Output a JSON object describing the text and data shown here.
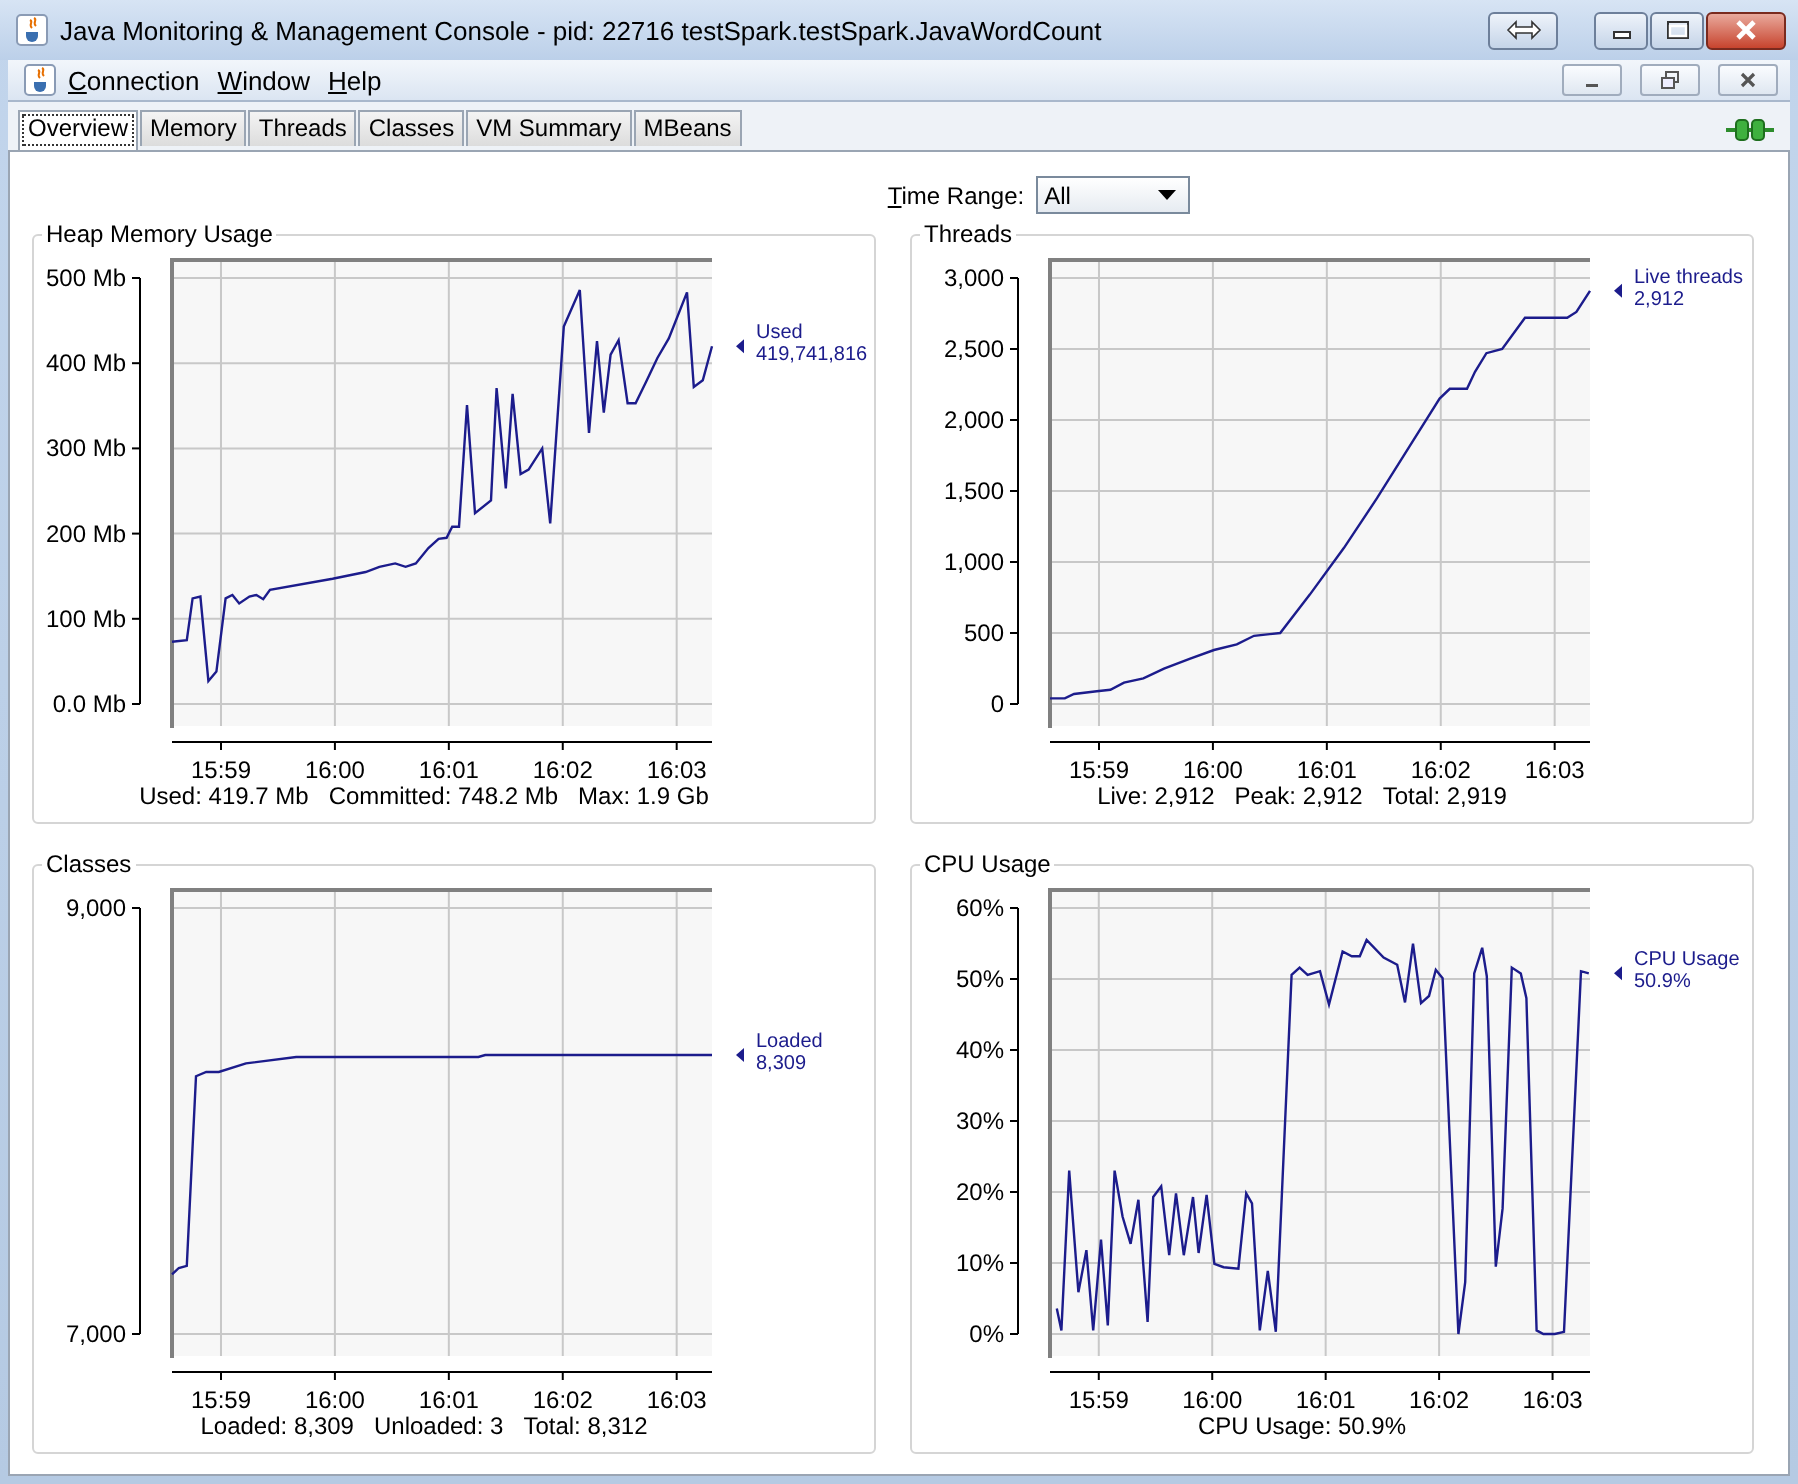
{
  "window": {
    "title": "Java Monitoring & Management Console - pid: 22716 testSpark.testSpark.JavaWordCount"
  },
  "menu": [
    "Connection",
    "Window",
    "Help"
  ],
  "tabs": [
    {
      "label": "Overview",
      "selected": true
    },
    {
      "label": "Memory",
      "selected": false
    },
    {
      "label": "Threads",
      "selected": false
    },
    {
      "label": "Classes",
      "selected": false
    },
    {
      "label": "VM Summary",
      "selected": false
    },
    {
      "label": "MBeans",
      "selected": false
    }
  ],
  "time_range": {
    "label": "Time Range:",
    "value": "All"
  },
  "panels": [
    {
      "title": "Heap Memory Usage",
      "legend": {
        "value": "419,741,816"
      },
      "stats": [
        "Used: 419.7 Mb",
        "Committed: 748.2 Mb",
        "Max: 1.9 Gb"
      ],
      "chart_data": {
        "type": "line",
        "x": [
          958.57,
          958.7,
          958.75,
          958.82,
          958.89,
          958.96,
          959.04,
          959.1,
          959.16,
          959.25,
          959.31,
          959.37,
          959.43,
          959.98,
          960.27,
          960.39,
          960.53,
          960.62,
          960.71,
          960.82,
          960.91,
          960.98,
          961.03,
          961.09,
          961.16,
          961.23,
          961.37,
          961.42,
          961.5,
          961.56,
          961.63,
          961.7,
          961.82,
          961.89,
          962.01,
          962.15,
          962.23,
          962.3,
          962.36,
          962.42,
          962.49,
          962.57,
          962.64,
          962.73,
          962.83,
          962.93,
          963.09,
          963.15,
          963.23,
          963.31
        ],
        "series": [
          {
            "name": "Used",
            "color": "#1c1c8c",
            "values": [
              73,
              75,
              124,
              126,
              27,
              38,
              124,
              128,
              118,
              126,
              128,
              123,
              134,
              147,
              155,
              161,
              165,
              161,
              165,
              183,
              194,
              195,
              208,
              208,
              351,
              224,
              239,
              371,
              253,
              364,
              270,
              275,
              300,
              212,
              443,
              486,
              318,
              426,
              342,
              410,
              427,
              353,
              353,
              378,
              406,
              429,
              483,
              372,
              380,
              420
            ]
          }
        ],
        "grid": true,
        "xlim": [
          958.57,
          963.31
        ],
        "ylim": [
          0,
          500
        ],
        "xticks": [
          {
            "value": 959,
            "label": "15:59"
          },
          {
            "value": 960,
            "label": "16:00"
          },
          {
            "value": 961,
            "label": "16:01"
          },
          {
            "value": 962,
            "label": "16:02"
          },
          {
            "value": 963,
            "label": "16:03"
          }
        ],
        "yticks": [
          {
            "value": 0,
            "label": "0.0 Mb"
          },
          {
            "value": 100,
            "label": "100 Mb"
          },
          {
            "value": 200,
            "label": "200 Mb"
          },
          {
            "value": 300,
            "label": "300 Mb"
          },
          {
            "value": 400,
            "label": "400 Mb"
          },
          {
            "value": 500,
            "label": "500 Mb"
          }
        ]
      }
    },
    {
      "title": "Threads",
      "legend": {
        "value": "2,912"
      },
      "stats": [
        "Live: 2,912",
        "Peak: 2,912",
        "Total: 2,919"
      ],
      "chart_data": {
        "type": "line",
        "x": [
          958.57,
          958.7,
          958.78,
          958.98,
          959.1,
          959.22,
          959.39,
          959.57,
          959.8,
          960.01,
          960.21,
          960.36,
          960.59,
          960.85,
          961.15,
          961.44,
          961.73,
          961.99,
          962.08,
          962.23,
          962.3,
          962.4,
          962.54,
          962.74,
          963.11,
          963.19,
          963.31
        ],
        "series": [
          {
            "name": "Live threads",
            "color": "#1c1c8c",
            "values": [
              40,
              40,
              70,
              90,
              100,
              150,
              180,
              250,
              320,
              380,
              420,
              480,
              500,
              770,
              1100,
              1450,
              1820,
              2150,
              2220,
              2220,
              2340,
              2470,
              2500,
              2720,
              2720,
              2760,
              2910
            ]
          }
        ],
        "grid": true,
        "xlim": [
          958.57,
          963.31
        ],
        "ylim": [
          0,
          3000
        ],
        "xticks": [
          {
            "value": 959,
            "label": "15:59"
          },
          {
            "value": 960,
            "label": "16:00"
          },
          {
            "value": 961,
            "label": "16:01"
          },
          {
            "value": 962,
            "label": "16:02"
          },
          {
            "value": 963,
            "label": "16:03"
          }
        ],
        "yticks": [
          {
            "value": 0,
            "label": "0"
          },
          {
            "value": 500,
            "label": "500"
          },
          {
            "value": 1000,
            "label": "1,000"
          },
          {
            "value": 1500,
            "label": "1,500"
          },
          {
            "value": 2000,
            "label": "2,000"
          },
          {
            "value": 2500,
            "label": "2,500"
          },
          {
            "value": 3000,
            "label": "3,000"
          }
        ]
      }
    },
    {
      "title": "Classes",
      "legend": {
        "value": "8,309"
      },
      "stats": [
        "Loaded: 8,309",
        "Unloaded: 3",
        "Total: 8,312"
      ],
      "chart_data": {
        "type": "line",
        "x": [
          958.57,
          958.63,
          958.7,
          958.78,
          958.87,
          958.98,
          959.22,
          959.66,
          961.26,
          961.32,
          963.31
        ],
        "series": [
          {
            "name": "Loaded",
            "color": "#1c1c8c",
            "values": [
              7280,
              7310,
              7320,
              8210,
              8230,
              8230,
              8270,
              8300,
              8300,
              8310,
              8310
            ]
          }
        ],
        "grid": true,
        "xlim": [
          958.57,
          963.31
        ],
        "ylim": [
          7000,
          9000
        ],
        "xticks": [
          {
            "value": 959,
            "label": "15:59"
          },
          {
            "value": 960,
            "label": "16:00"
          },
          {
            "value": 961,
            "label": "16:01"
          },
          {
            "value": 962,
            "label": "16:02"
          },
          {
            "value": 963,
            "label": "16:03"
          }
        ],
        "yticks": [
          {
            "value": 7000,
            "label": "7,000"
          },
          {
            "value": 9000,
            "label": "9,000"
          }
        ]
      }
    },
    {
      "title": "CPU Usage",
      "legend": {
        "value": "50.9%"
      },
      "stats": [
        "CPU Usage: 50.9%"
      ],
      "chart_data": {
        "type": "line",
        "x": [
          958.63,
          958.67,
          958.74,
          958.82,
          958.89,
          958.95,
          959.02,
          959.08,
          959.14,
          959.21,
          959.28,
          959.35,
          959.43,
          959.48,
          959.55,
          959.62,
          959.68,
          959.75,
          959.83,
          959.88,
          959.95,
          960.02,
          960.1,
          960.23,
          960.3,
          960.35,
          960.42,
          960.49,
          960.56,
          960.7,
          960.77,
          960.84,
          960.95,
          961.03,
          961.15,
          961.23,
          961.3,
          961.36,
          961.51,
          961.63,
          961.7,
          961.77,
          961.84,
          961.91,
          961.97,
          962.03,
          962.17,
          962.23,
          962.31,
          962.38,
          962.42,
          962.5,
          962.56,
          962.64,
          962.72,
          962.77,
          962.86,
          962.92,
          963.02,
          963.1,
          963.25,
          963.32
        ],
        "series": [
          {
            "name": "CPU Usage",
            "color": "#1c1c8c",
            "values": [
              3.6,
              0.5,
              23,
              5.9,
              11.8,
              0.5,
              13.3,
              1.2,
              23,
              16.5,
              12.7,
              18.9,
              1.7,
              19.3,
              20.8,
              11.1,
              19.8,
              11.1,
              19.3,
              11.4,
              19.6,
              9.9,
              9.4,
              9.2,
              19.8,
              18.4,
              0.5,
              8.9,
              0.3,
              50.6,
              51.6,
              50.6,
              51.1,
              46.4,
              53.9,
              53.2,
              53.2,
              55.5,
              53,
              52,
              46.7,
              55,
              46.6,
              47.6,
              51.3,
              50.1,
              0,
              7.3,
              50.8,
              54.4,
              50.4,
              9.5,
              17.7,
              51.6,
              50.8,
              47.3,
              0.5,
              0,
              0,
              0.3,
              51.1,
              50.8
            ]
          }
        ],
        "grid": true,
        "xlim": [
          958.57,
          963.33
        ],
        "ylim": [
          0,
          60
        ],
        "xticks": [
          {
            "value": 959,
            "label": "15:59"
          },
          {
            "value": 960,
            "label": "16:00"
          },
          {
            "value": 961,
            "label": "16:01"
          },
          {
            "value": 962,
            "label": "16:02"
          },
          {
            "value": 963,
            "label": "16:03"
          }
        ],
        "yticks": [
          {
            "value": 0,
            "label": "0%"
          },
          {
            "value": 10,
            "label": "10%"
          },
          {
            "value": 20,
            "label": "20%"
          },
          {
            "value": 30,
            "label": "30%"
          },
          {
            "value": 40,
            "label": "40%"
          },
          {
            "value": 50,
            "label": "50%"
          },
          {
            "value": 60,
            "label": "60%"
          }
        ]
      }
    }
  ]
}
